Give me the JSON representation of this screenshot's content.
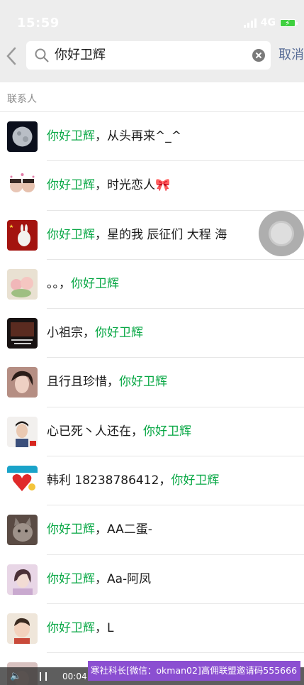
{
  "status": {
    "time": "15:59",
    "network": "4G"
  },
  "search": {
    "query": "你好卫辉",
    "cancel_label": "取消"
  },
  "section_title": "联系人",
  "results": [
    {
      "pre": "",
      "hl": "你好卫辉",
      "post": "，从头再来^_^",
      "avatar": "moon"
    },
    {
      "pre": "",
      "hl": "你好卫辉",
      "post": "，时光恋人🎀",
      "avatar": "couple"
    },
    {
      "pre": "",
      "hl": "你好卫辉",
      "post": "，星的我 辰征们 大程 海",
      "avatar": "red"
    },
    {
      "pre": "。。，",
      "hl": "你好卫辉",
      "post": "",
      "avatar": "pink-flower"
    },
    {
      "pre": "小祖宗，",
      "hl": "你好卫辉",
      "post": "",
      "avatar": "dark-text"
    },
    {
      "pre": "且行且珍惜，",
      "hl": "你好卫辉",
      "post": "",
      "avatar": "woman"
    },
    {
      "pre": "心已死丶人还在，",
      "hl": "你好卫辉",
      "post": "",
      "avatar": "man"
    },
    {
      "pre": "韩利 18238786412，",
      "hl": "你好卫辉",
      "post": "",
      "avatar": "balloon"
    },
    {
      "pre": "",
      "hl": "你好卫辉",
      "post": "，AA二蛋-",
      "avatar": "cat"
    },
    {
      "pre": "",
      "hl": "你好卫辉",
      "post": "，Aa-阿凤",
      "avatar": "girl-pink"
    },
    {
      "pre": "",
      "hl": "你好卫辉",
      "post": "，L",
      "avatar": "baby"
    }
  ],
  "video": {
    "time": "00:04"
  },
  "promo_text": "寒社科长[微信：okman02]高佣联盟邀请码555666",
  "colors": {
    "highlight": "#07a744",
    "cancel": "#576b95",
    "promo": "#8b4fd1"
  }
}
